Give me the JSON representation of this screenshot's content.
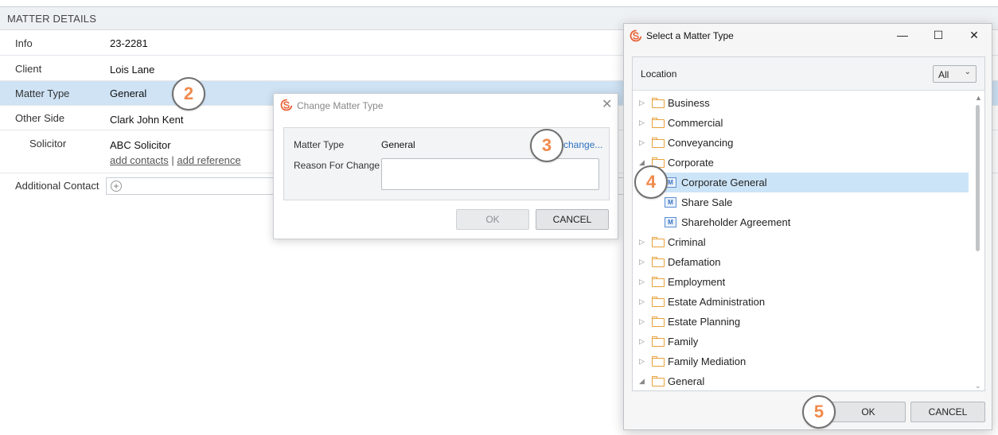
{
  "matter_details": {
    "header": "MATTER DETAILS",
    "rows": [
      {
        "label": "Info",
        "value": "23-2281"
      },
      {
        "label": "Client",
        "value": "Lois Lane"
      },
      {
        "label": "Matter Type",
        "value": "General"
      },
      {
        "label": "Other Side",
        "value": "Clark John Kent"
      },
      {
        "label": "Solicitor",
        "value": "ABC Solicitor"
      },
      {
        "label": "Additional Contact",
        "value": ""
      }
    ],
    "add_contacts": "add contacts",
    "separator": "|",
    "add_reference": "add reference",
    "plus_glyph": "+"
  },
  "steps": [
    "2",
    "3",
    "4",
    "5"
  ],
  "change_dialog": {
    "title": "Change Matter Type",
    "close_glyph": "✕",
    "matter_type_label": "Matter Type",
    "matter_type_value": "General",
    "change_link": "change...",
    "reason_label": "Reason For Change",
    "reason_value": "",
    "ok": "OK",
    "cancel": "CANCEL"
  },
  "select_window": {
    "title": "Select a Matter Type",
    "minimize_glyph": "—",
    "maximize_glyph": "☐",
    "close_glyph": "✕",
    "location_label": "Location",
    "location_value": "All",
    "tree": [
      {
        "label": "Business",
        "kind": "folder",
        "level": 0,
        "state": "collapsed"
      },
      {
        "label": "Commercial",
        "kind": "folder",
        "level": 0,
        "state": "collapsed"
      },
      {
        "label": "Conveyancing",
        "kind": "folder",
        "level": 0,
        "state": "collapsed"
      },
      {
        "label": "Corporate",
        "kind": "folder",
        "level": 0,
        "state": "expanded"
      },
      {
        "label": "Corporate General",
        "kind": "type",
        "level": 1,
        "selected": true
      },
      {
        "label": "Share Sale",
        "kind": "type",
        "level": 1
      },
      {
        "label": "Shareholder Agreement",
        "kind": "type",
        "level": 1
      },
      {
        "label": "Criminal",
        "kind": "folder",
        "level": 0,
        "state": "collapsed"
      },
      {
        "label": "Defamation",
        "kind": "folder",
        "level": 0,
        "state": "collapsed"
      },
      {
        "label": "Employment",
        "kind": "folder",
        "level": 0,
        "state": "collapsed"
      },
      {
        "label": "Estate Administration",
        "kind": "folder",
        "level": 0,
        "state": "collapsed"
      },
      {
        "label": "Estate Planning",
        "kind": "folder",
        "level": 0,
        "state": "collapsed"
      },
      {
        "label": "Family",
        "kind": "folder",
        "level": 0,
        "state": "collapsed"
      },
      {
        "label": "Family Mediation",
        "kind": "folder",
        "level": 0,
        "state": "collapsed"
      },
      {
        "label": "General",
        "kind": "folder",
        "level": 0,
        "state": "expanded"
      }
    ],
    "ok": "OK",
    "cancel": "CANCEL"
  },
  "colors": {
    "selection": "#cfe3f5",
    "step_number": "#f08a4b",
    "folder": "#e8a13a",
    "link": "#2d72c2",
    "logo": "#e8643a"
  }
}
